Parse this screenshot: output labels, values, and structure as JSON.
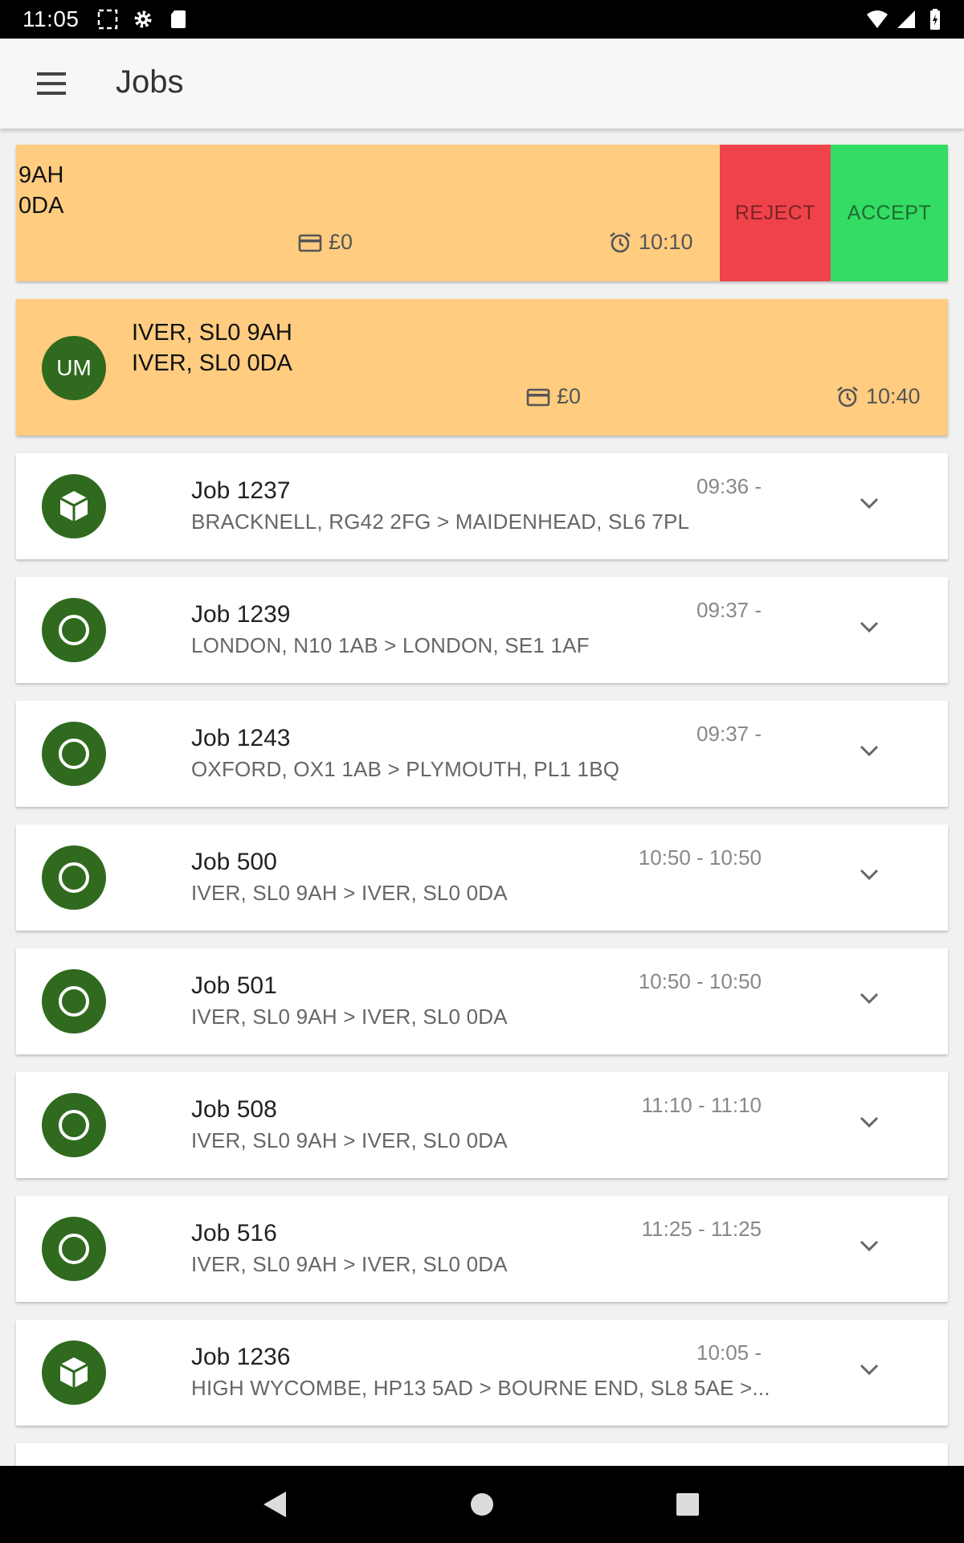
{
  "status_bar": {
    "time": "11:05"
  },
  "app_bar": {
    "title": "Jobs"
  },
  "offers": [
    {
      "line1": "9AH",
      "line2": "0DA",
      "price": "£0",
      "time": "10:10",
      "reject_label": "REJECT",
      "accept_label": "ACCEPT"
    },
    {
      "avatar": "UM",
      "line1": "IVER, SL0 9AH",
      "line2": "IVER, SL0 0DA",
      "price": "£0",
      "time": "10:40"
    }
  ],
  "jobs": [
    {
      "title": "Job 1237",
      "route": "BRACKNELL, RG42 2FG > MAIDENHEAD, SL6 7PL",
      "time": "09:36 -",
      "icon": "package-icon"
    },
    {
      "title": "Job 1239",
      "route": "LONDON, N10 1AB > LONDON, SE1 1AF",
      "time": "09:37 -",
      "icon": "circle-icon"
    },
    {
      "title": "Job 1243",
      "route": "OXFORD, OX1 1AB > PLYMOUTH, PL1 1BQ",
      "time": "09:37 -",
      "icon": "circle-icon"
    },
    {
      "title": "Job 500",
      "route": "IVER, SL0 9AH > IVER, SL0 0DA",
      "time": "10:50 - 10:50",
      "icon": "circle-icon"
    },
    {
      "title": "Job 501",
      "route": "IVER, SL0 9AH > IVER, SL0 0DA",
      "time": "10:50 - 10:50",
      "icon": "circle-icon"
    },
    {
      "title": "Job 508",
      "route": "IVER, SL0 9AH > IVER, SL0 0DA",
      "time": "11:10 - 11:10",
      "icon": "circle-icon"
    },
    {
      "title": "Job 516",
      "route": "IVER, SL0 9AH > IVER, SL0 0DA",
      "time": "11:25 - 11:25",
      "icon": "circle-icon"
    },
    {
      "title": "Job 1236",
      "route": "HIGH WYCOMBE, HP13 5AD > BOURNE END, SL8 5AE >...",
      "time": "10:05 -",
      "icon": "package-icon"
    }
  ],
  "colors": {
    "offer_bg": "#ffcc80",
    "reject": "#f0424a",
    "accept": "#33dc62",
    "icon_bg": "#2f6a1e"
  }
}
